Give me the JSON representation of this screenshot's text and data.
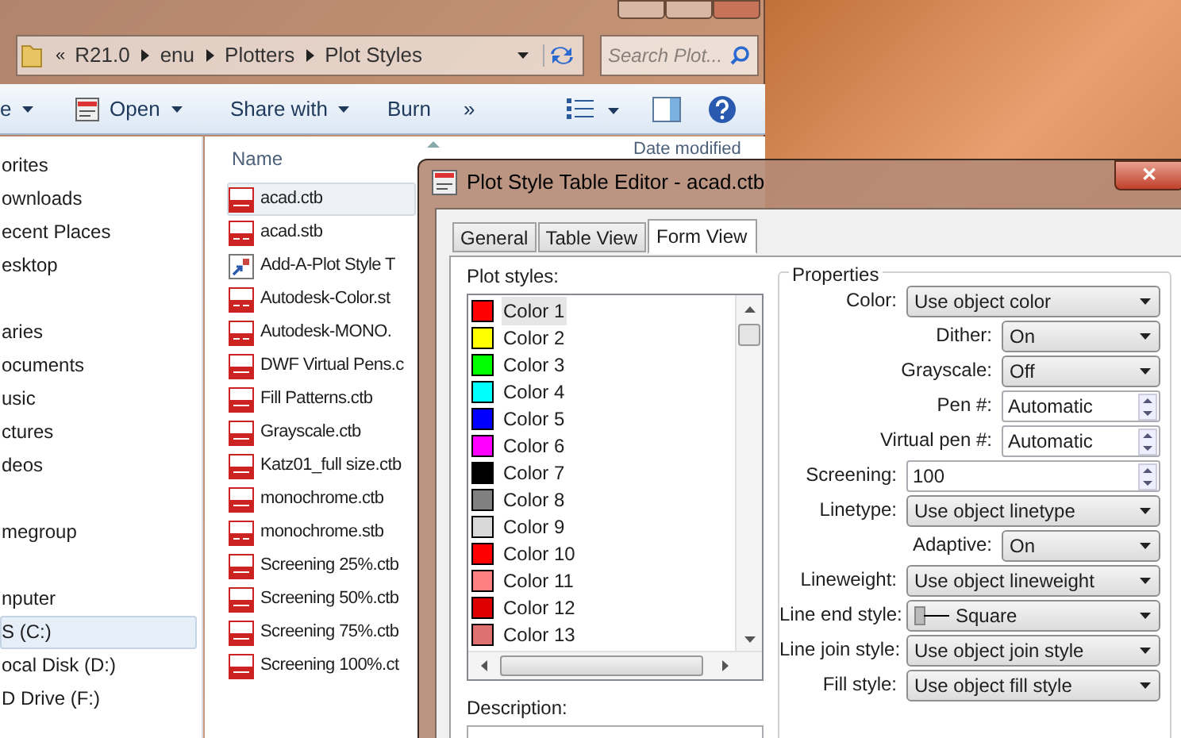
{
  "explorer": {
    "address": {
      "overflow": "«",
      "crumbs": [
        "R21.0",
        "enu",
        "Plotters",
        "Plot Styles"
      ]
    },
    "search": {
      "placeholder": "Search Plot..."
    },
    "toolbar": [
      {
        "label": "e",
        "kind": "menu"
      },
      {
        "label": "Open",
        "kind": "open"
      },
      {
        "label": "Share with",
        "kind": "menu"
      },
      {
        "label": "Burn",
        "kind": "plain"
      },
      {
        "label": "»",
        "kind": "plain"
      }
    ],
    "nav": [
      {
        "items": [
          {
            "label": "orites",
            "selected": false
          },
          {
            "label": "ownloads",
            "selected": false
          },
          {
            "label": "ecent Places",
            "selected": false
          },
          {
            "label": "esktop",
            "selected": false
          }
        ]
      },
      {
        "items": [
          {
            "label": "aries",
            "selected": false
          },
          {
            "label": "ocuments",
            "selected": false
          },
          {
            "label": "usic",
            "selected": false
          },
          {
            "label": "ctures",
            "selected": false
          },
          {
            "label": "deos",
            "selected": false
          }
        ]
      },
      {
        "items": [
          {
            "label": "megroup",
            "selected": false
          }
        ]
      },
      {
        "items": [
          {
            "label": "nputer",
            "selected": false
          },
          {
            "label": "S (C:)",
            "selected": true
          },
          {
            "label": "ocal Disk (D:)",
            "selected": false
          },
          {
            "label": "D Drive (F:)",
            "selected": false
          }
        ]
      }
    ],
    "columns": [
      "Name",
      "Date modified"
    ],
    "files": [
      {
        "name": "acad.ctb",
        "kind": "ctb",
        "selected": true
      },
      {
        "name": "acad.stb",
        "kind": "stb",
        "selected": false
      },
      {
        "name": "Add-A-Plot Style T",
        "kind": "shortcut",
        "selected": false
      },
      {
        "name": "Autodesk-Color.st",
        "kind": "stb",
        "selected": false
      },
      {
        "name": "Autodesk-MONO.",
        "kind": "stb",
        "selected": false
      },
      {
        "name": "DWF Virtual Pens.c",
        "kind": "ctb",
        "selected": false
      },
      {
        "name": "Fill Patterns.ctb",
        "kind": "ctb",
        "selected": false
      },
      {
        "name": "Grayscale.ctb",
        "kind": "ctb",
        "selected": false
      },
      {
        "name": "Katz01_full size.ctb",
        "kind": "ctb",
        "selected": false
      },
      {
        "name": "monochrome.ctb",
        "kind": "ctb",
        "selected": false
      },
      {
        "name": "monochrome.stb",
        "kind": "stb",
        "selected": false
      },
      {
        "name": "Screening 25%.ctb",
        "kind": "ctb",
        "selected": false
      },
      {
        "name": "Screening 50%.ctb",
        "kind": "ctb",
        "selected": false
      },
      {
        "name": "Screening 75%.ctb",
        "kind": "ctb",
        "selected": false
      },
      {
        "name": "Screening 100%.ct",
        "kind": "ctb",
        "selected": false
      }
    ]
  },
  "dialog": {
    "title": "Plot Style Table Editor - acad.ctb",
    "close": "✕",
    "tabs": [
      {
        "label": "General",
        "selected": false
      },
      {
        "label": "Table View",
        "selected": false
      },
      {
        "label": "Form View",
        "selected": true
      }
    ],
    "plot_styles_label": "Plot styles:",
    "plot_styles": [
      {
        "name": "Color 1",
        "color": "#ff0000",
        "selected": true
      },
      {
        "name": "Color 2",
        "color": "#ffff00",
        "selected": false
      },
      {
        "name": "Color 3",
        "color": "#00ff00",
        "selected": false
      },
      {
        "name": "Color 4",
        "color": "#00ffff",
        "selected": false
      },
      {
        "name": "Color 5",
        "color": "#0000ff",
        "selected": false
      },
      {
        "name": "Color 6",
        "color": "#ff00ff",
        "selected": false
      },
      {
        "name": "Color 7",
        "color": "#000000",
        "selected": false
      },
      {
        "name": "Color 8",
        "color": "#808080",
        "selected": false
      },
      {
        "name": "Color 9",
        "color": "#d9d9d9",
        "selected": false
      },
      {
        "name": "Color 10",
        "color": "#ff0000",
        "selected": false
      },
      {
        "name": "Color 11",
        "color": "#ff8080",
        "selected": false
      },
      {
        "name": "Color 12",
        "color": "#dd0000",
        "selected": false
      },
      {
        "name": "Color 13",
        "color": "#dd7070",
        "selected": false
      }
    ],
    "description_label": "Description:",
    "properties_title": "Properties",
    "properties": [
      {
        "label": "Color:",
        "value": "Use object color",
        "kind": "combo"
      },
      {
        "label": "Dither:",
        "value": "On",
        "kind": "shortcombo"
      },
      {
        "label": "Grayscale:",
        "value": "Off",
        "kind": "shortcombo"
      },
      {
        "label": "Pen #:",
        "value": "Automatic",
        "kind": "spin"
      },
      {
        "label": "Virtual pen #:",
        "value": "Automatic",
        "kind": "spin"
      },
      {
        "label": "Screening:",
        "value": "100",
        "kind": "widespin"
      },
      {
        "label": "Linetype:",
        "value": "Use object linetype",
        "kind": "combo"
      },
      {
        "label": "Adaptive:",
        "value": "On",
        "kind": "shortcombo"
      },
      {
        "label": "Lineweight:",
        "value": "Use object lineweight",
        "kind": "combo"
      },
      {
        "label": "Line end style:",
        "value": "Square",
        "kind": "stylecombo"
      },
      {
        "label": "Line join style:",
        "value": "Use object join style",
        "kind": "combo"
      },
      {
        "label": "Fill style:",
        "value": "Use object fill style",
        "kind": "combo"
      }
    ]
  }
}
